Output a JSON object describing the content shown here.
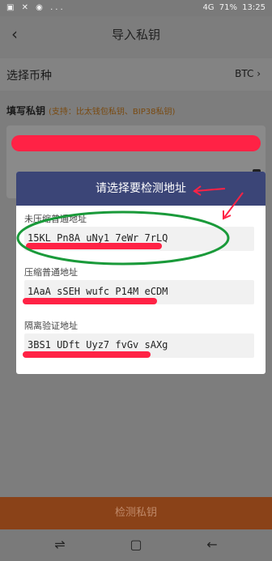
{
  "status_bar": {
    "left_icons": [
      "photo-icon",
      "cat-icon",
      "game-icon",
      "more-icon"
    ],
    "left_text": "▣ ✕ ◉ ...",
    "battery": "71%",
    "time": "13:25",
    "signal": "4G"
  },
  "header": {
    "title": "导入私钥",
    "back_icon": "chevron-left-icon"
  },
  "coin": {
    "label": "选择币种",
    "value": "BTC"
  },
  "fill": {
    "label": "填写私钥",
    "note": "(支持：比太钱包私钥、BIP38私钥)"
  },
  "button": {
    "label": "检测私钥"
  },
  "dialog": {
    "title": "请选择要检测地址",
    "sections": [
      {
        "label": "未压缩普通地址",
        "address": "15KL Pn8A uNy1 7eWr 7rLQ"
      },
      {
        "label": "压缩普通地址",
        "address": "1AaA sSEH wufc P14M eCDM"
      },
      {
        "label": "隔离验证地址",
        "address": "3BS1 UDft Uyz7 fvGv sAXg"
      }
    ]
  },
  "colors": {
    "dialog_header": "#3b4577",
    "button": "#8a4218",
    "annotation": "#ff2245",
    "highlight": "#1a9a3a"
  }
}
